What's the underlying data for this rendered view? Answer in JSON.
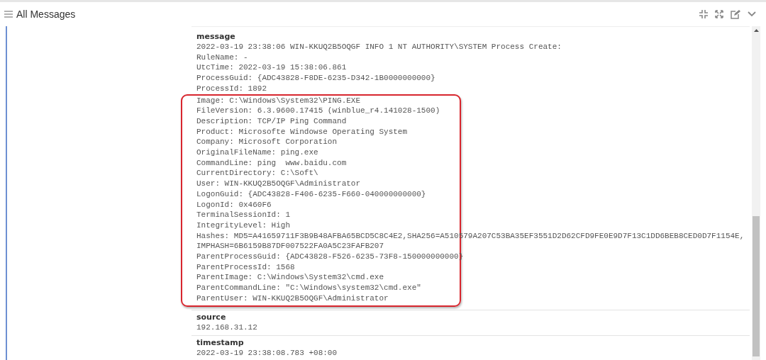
{
  "panel": {
    "title": "All Messages"
  },
  "fields": [
    {
      "name": "message",
      "lines": [
        "2022-03-19 23:38:06 WIN-KKUQ2B5OQGF INFO 1 NT AUTHORITY\\SYSTEM Process Create:",
        "RuleName: -",
        "UtcTime: 2022-03-19 15:38:06.861",
        "ProcessGuid: {ADC43828-F8DE-6235-D342-1B0000000000}",
        "ProcessId: 1892"
      ],
      "highlighted_lines": [
        "Image: C:\\Windows\\System32\\PING.EXE",
        "FileVersion: 6.3.9600.17415 (winblue_r4.141028-1500)",
        "Description: TCP/IP Ping Command",
        "Product: Microsofte Windowse Operating System",
        "Company: Microsoft Corporation",
        "OriginalFileName: ping.exe",
        "CommandLine: ping  www.baidu.com",
        "CurrentDirectory: C:\\Soft\\",
        "User: WIN-KKUQ2B5OQGF\\Administrator",
        "LogonGuid: {ADC43828-F406-6235-F660-040000000000}",
        "LogonId: 0x460F6",
        "TerminalSessionId: 1",
        "IntegrityLevel: High",
        "Hashes: MD5=A41659711F3B9B48AFBA65BCD5C8C4E2,SHA256=A510579A207C53BA35EF3551D2D62CFD9FE0E9D7F13C1DD6BEB8CED0D7F1154E,IMPHASH=6B6159B87DF007522FA0A5C23FAFB207",
        "ParentProcessGuid: {ADC43828-F526-6235-73F8-150000000000}",
        "ParentProcessId: 1568",
        "ParentImage: C:\\Windows\\System32\\cmd.exe",
        "ParentCommandLine: \"C:\\Windows\\system32\\cmd.exe\"",
        "ParentUser: WIN-KKUQ2B5OQGF\\Administrator"
      ]
    },
    {
      "name": "source",
      "lines": [
        "192.168.31.12"
      ]
    },
    {
      "name": "timestamp",
      "lines": [
        "2022-03-19 23:38:08.783 +08:00"
      ]
    }
  ]
}
